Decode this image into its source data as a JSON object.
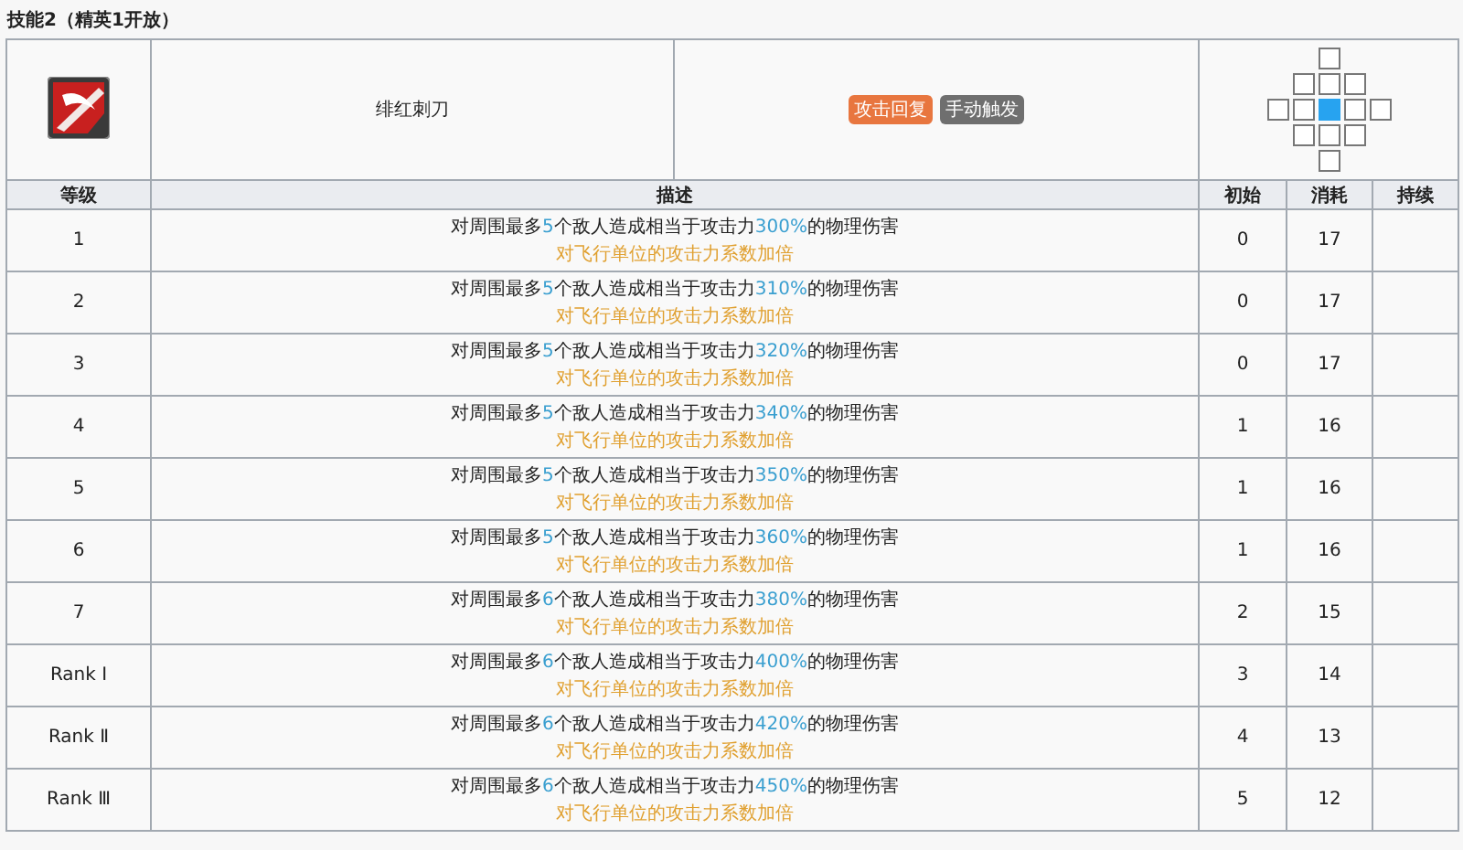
{
  "title": "技能2（精英1开放）",
  "skill": {
    "name": "绯红刺刀",
    "tags": [
      {
        "text": "攻击回复",
        "color": "#e8763f"
      },
      {
        "text": "手动触发",
        "color": "#6f6f6f"
      }
    ],
    "range": [
      {
        "cells": [
          {
            "kind": "none"
          },
          {
            "kind": "none"
          },
          {
            "kind": "tile"
          },
          {
            "kind": "none"
          },
          {
            "kind": "none"
          }
        ]
      },
      {
        "cells": [
          {
            "kind": "none"
          },
          {
            "kind": "tile"
          },
          {
            "kind": "tile"
          },
          {
            "kind": "tile"
          },
          {
            "kind": "none"
          }
        ]
      },
      {
        "cells": [
          {
            "kind": "tile"
          },
          {
            "kind": "tile"
          },
          {
            "kind": "self"
          },
          {
            "kind": "tile"
          },
          {
            "kind": "tile"
          }
        ]
      },
      {
        "cells": [
          {
            "kind": "none"
          },
          {
            "kind": "tile"
          },
          {
            "kind": "tile"
          },
          {
            "kind": "tile"
          },
          {
            "kind": "none"
          }
        ]
      },
      {
        "cells": [
          {
            "kind": "none"
          },
          {
            "kind": "none"
          },
          {
            "kind": "tile"
          },
          {
            "kind": "none"
          },
          {
            "kind": "none"
          }
        ]
      }
    ]
  },
  "columns": [
    "等级",
    "描述",
    "初始",
    "消耗",
    "持续"
  ],
  "rows": [
    {
      "level": "1",
      "parts": [
        {
          "kind": "text",
          "text": "对周围最多"
        },
        {
          "kind": "value",
          "text": "5"
        },
        {
          "kind": "text",
          "text": "个敌人造成相当于攻击力"
        },
        {
          "kind": "value",
          "text": "300%"
        },
        {
          "kind": "text",
          "text": "的物理伤害"
        }
      ],
      "note": "对飞行单位的攻击力系数加倍",
      "initial": "0",
      "cost": "17"
    },
    {
      "level": "2",
      "parts": [
        {
          "kind": "text",
          "text": "对周围最多"
        },
        {
          "kind": "value",
          "text": "5"
        },
        {
          "kind": "text",
          "text": "个敌人造成相当于攻击力"
        },
        {
          "kind": "value",
          "text": "310%"
        },
        {
          "kind": "text",
          "text": "的物理伤害"
        }
      ],
      "note": "对飞行单位的攻击力系数加倍",
      "initial": "0",
      "cost": "17"
    },
    {
      "level": "3",
      "parts": [
        {
          "kind": "text",
          "text": "对周围最多"
        },
        {
          "kind": "value",
          "text": "5"
        },
        {
          "kind": "text",
          "text": "个敌人造成相当于攻击力"
        },
        {
          "kind": "value",
          "text": "320%"
        },
        {
          "kind": "text",
          "text": "的物理伤害"
        }
      ],
      "note": "对飞行单位的攻击力系数加倍",
      "initial": "0",
      "cost": "17"
    },
    {
      "level": "4",
      "parts": [
        {
          "kind": "text",
          "text": "对周围最多"
        },
        {
          "kind": "value",
          "text": "5"
        },
        {
          "kind": "text",
          "text": "个敌人造成相当于攻击力"
        },
        {
          "kind": "value",
          "text": "340%"
        },
        {
          "kind": "text",
          "text": "的物理伤害"
        }
      ],
      "note": "对飞行单位的攻击力系数加倍",
      "initial": "1",
      "cost": "16"
    },
    {
      "level": "5",
      "parts": [
        {
          "kind": "text",
          "text": "对周围最多"
        },
        {
          "kind": "value",
          "text": "5"
        },
        {
          "kind": "text",
          "text": "个敌人造成相当于攻击力"
        },
        {
          "kind": "value",
          "text": "350%"
        },
        {
          "kind": "text",
          "text": "的物理伤害"
        }
      ],
      "note": "对飞行单位的攻击力系数加倍",
      "initial": "1",
      "cost": "16"
    },
    {
      "level": "6",
      "parts": [
        {
          "kind": "text",
          "text": "对周围最多"
        },
        {
          "kind": "value",
          "text": "5"
        },
        {
          "kind": "text",
          "text": "个敌人造成相当于攻击力"
        },
        {
          "kind": "value",
          "text": "360%"
        },
        {
          "kind": "text",
          "text": "的物理伤害"
        }
      ],
      "note": "对飞行单位的攻击力系数加倍",
      "initial": "1",
      "cost": "16"
    },
    {
      "level": "7",
      "parts": [
        {
          "kind": "text",
          "text": "对周围最多"
        },
        {
          "kind": "value",
          "text": "6"
        },
        {
          "kind": "text",
          "text": "个敌人造成相当于攻击力"
        },
        {
          "kind": "value",
          "text": "380%"
        },
        {
          "kind": "text",
          "text": "的物理伤害"
        }
      ],
      "note": "对飞行单位的攻击力系数加倍",
      "initial": "2",
      "cost": "15"
    },
    {
      "level": "Rank Ⅰ",
      "parts": [
        {
          "kind": "text",
          "text": "对周围最多"
        },
        {
          "kind": "value",
          "text": "6"
        },
        {
          "kind": "text",
          "text": "个敌人造成相当于攻击力"
        },
        {
          "kind": "value",
          "text": "400%"
        },
        {
          "kind": "text",
          "text": "的物理伤害"
        }
      ],
      "note": "对飞行单位的攻击力系数加倍",
      "initial": "3",
      "cost": "14"
    },
    {
      "level": "Rank Ⅱ",
      "parts": [
        {
          "kind": "text",
          "text": "对周围最多"
        },
        {
          "kind": "value",
          "text": "6"
        },
        {
          "kind": "text",
          "text": "个敌人造成相当于攻击力"
        },
        {
          "kind": "value",
          "text": "420%"
        },
        {
          "kind": "text",
          "text": "的物理伤害"
        }
      ],
      "note": "对飞行单位的攻击力系数加倍",
      "initial": "4",
      "cost": "13"
    },
    {
      "level": "Rank Ⅲ",
      "parts": [
        {
          "kind": "text",
          "text": "对周围最多"
        },
        {
          "kind": "value",
          "text": "6"
        },
        {
          "kind": "text",
          "text": "个敌人造成相当于攻击力"
        },
        {
          "kind": "value",
          "text": "450%"
        },
        {
          "kind": "text",
          "text": "的物理伤害"
        }
      ],
      "note": "对飞行单位的攻击力系数加倍",
      "initial": "5",
      "cost": "12"
    }
  ]
}
